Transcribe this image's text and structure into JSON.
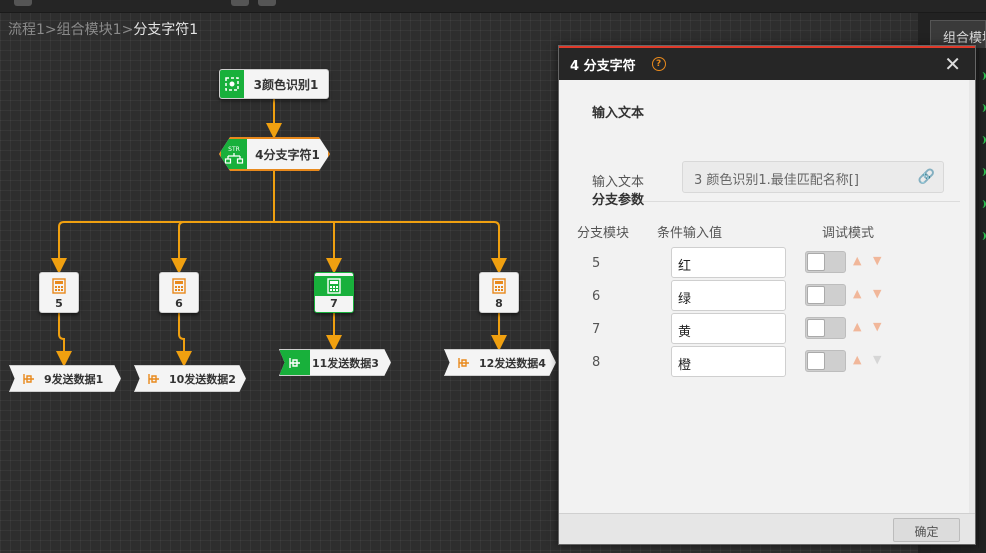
{
  "breadcrumb": {
    "part1": "流程1",
    "sep1": ">",
    "part2": "组合模块1",
    "sep2": ">",
    "current": "分支字符1"
  },
  "right_tab": {
    "label": "组合模块"
  },
  "flow": {
    "color_node": {
      "label": "3颜色识别1",
      "icon": "color-recognition-icon"
    },
    "branch_node": {
      "label": "4分支字符1",
      "icon": "str-branch-icon",
      "icon_text": "STR"
    },
    "calc_nodes": [
      {
        "label": "5",
        "icon": "calculator-icon"
      },
      {
        "label": "6",
        "icon": "calculator-icon"
      },
      {
        "label": "7",
        "icon": "calculator-icon"
      },
      {
        "label": "8",
        "icon": "calculator-icon"
      }
    ],
    "send_nodes": [
      {
        "label": "9发送数据1",
        "icon": "send-data-icon"
      },
      {
        "label": "10发送数据2",
        "icon": "send-data-icon"
      },
      {
        "label": "11发送数据3",
        "icon": "send-data-icon"
      },
      {
        "label": "12发送数据4",
        "icon": "send-data-icon"
      }
    ]
  },
  "dialog": {
    "title": "4 分支字符",
    "help_glyph": "?",
    "close_glyph": "✕",
    "input_section": "输入文本",
    "input_label": "输入文本",
    "input_value": "3 颜色识别1.最佳匹配名称[]",
    "link_glyph": "🔗",
    "branch_section": "分支参数",
    "columns": {
      "module": "分支模块",
      "condition": "条件输入值",
      "debug": "调试模式"
    },
    "rows": [
      {
        "module": "5",
        "value": "红"
      },
      {
        "module": "6",
        "value": "绿"
      },
      {
        "module": "7",
        "value": "黄"
      },
      {
        "module": "8",
        "value": "橙"
      }
    ],
    "ok_label": "确定"
  },
  "colors": {
    "accent": "#e8891c",
    "selected": "#18b03b",
    "header_line": "#e03a2a"
  }
}
